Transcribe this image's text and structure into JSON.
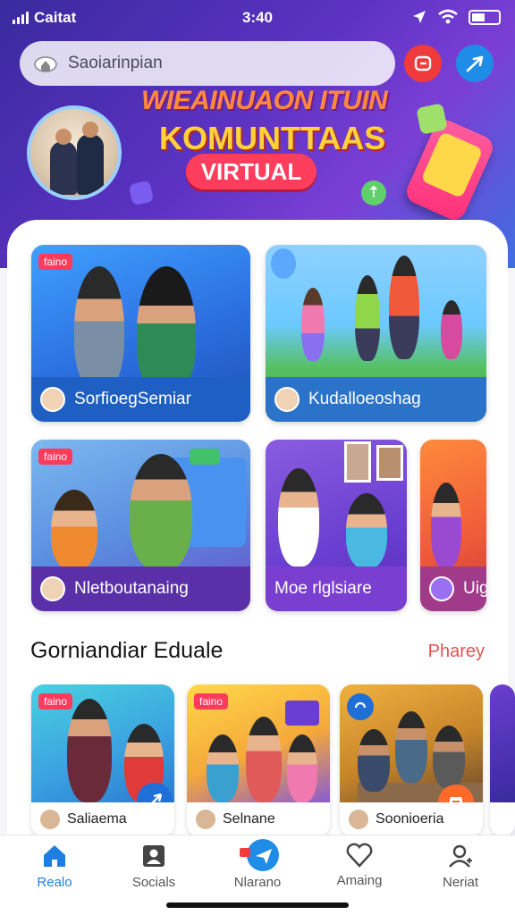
{
  "status_bar": {
    "carrier": "Caitat",
    "time": "3:40"
  },
  "search": {
    "placeholder": "Saoiarinpian"
  },
  "banner": {
    "line1": "WIEAINUAON ITUIN",
    "line2": "KOMUNTTAAS",
    "pill": "VIRTUAL"
  },
  "featured_cards": [
    {
      "label": "SorfioeɡSemiar",
      "tag": "faino"
    },
    {
      "label": "Kudalloeoshag"
    },
    {
      "label": "Nletboutanaing",
      "tag": "faino"
    },
    {
      "label": "Moe rlglsiare"
    },
    {
      "label": "Uig"
    }
  ],
  "section": {
    "title": "Gorniandiar Eduale",
    "link": "Pharey"
  },
  "small_cards": [
    {
      "label": "Saliaema",
      "tag": "faino"
    },
    {
      "label": "Selnane",
      "tag": "faino"
    },
    {
      "label": "Soonioeria"
    }
  ],
  "tabs": [
    {
      "label": "Realo",
      "icon": "home-icon"
    },
    {
      "label": "Socials",
      "icon": "contact-icon"
    },
    {
      "label": "Nlarano",
      "icon": "send-icon"
    },
    {
      "label": "Amaing",
      "icon": "heart-icon"
    },
    {
      "label": "Neriat",
      "icon": "profile-icon"
    }
  ],
  "colors": {
    "accent": "#1f7fe0",
    "header": "#5b32c2",
    "alert": "#ef3b3b"
  }
}
